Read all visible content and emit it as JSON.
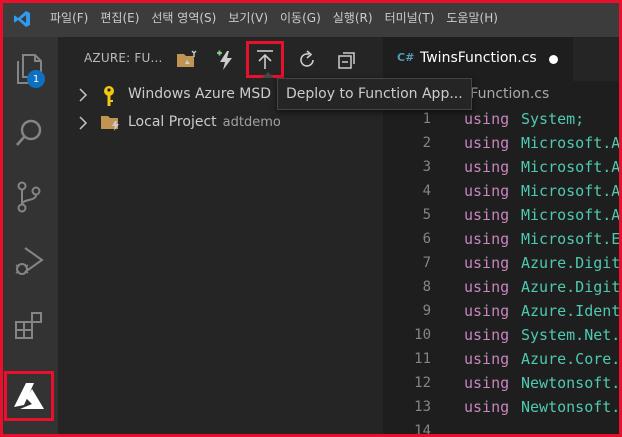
{
  "menu": [
    "파일(F)",
    "편집(E)",
    "선택 영역(S)",
    "보기(V)",
    "이동(G)",
    "실행(R)",
    "터미널(T)",
    "도움말(H)"
  ],
  "activity": {
    "explorer_badge": "1",
    "items": [
      "files-icon",
      "search-icon",
      "source-control-icon",
      "run-debug-icon",
      "extensions-icon",
      "azure-icon"
    ]
  },
  "sidebar": {
    "title": "AZURE: FU...",
    "tree": [
      {
        "label": "Windows Azure MSD",
        "desc": ""
      },
      {
        "label": "Local Project",
        "desc": "adtdemo"
      }
    ]
  },
  "tooltip": "Deploy to Function App...",
  "editor": {
    "tab": {
      "icon": "C#",
      "name": "TwinsFunction.cs"
    },
    "breadcrumb": "sFunction.cs",
    "lines": [
      {
        "n": "1",
        "kw": "using",
        "ns": "System;"
      },
      {
        "n": "2",
        "kw": "using",
        "ns": "Microsoft.A"
      },
      {
        "n": "3",
        "kw": "using",
        "ns": "Microsoft.A"
      },
      {
        "n": "4",
        "kw": "using",
        "ns": "Microsoft.A"
      },
      {
        "n": "5",
        "kw": "using",
        "ns": "Microsoft.A"
      },
      {
        "n": "6",
        "kw": "using",
        "ns": "Microsoft.E"
      },
      {
        "n": "7",
        "kw": "using",
        "ns": "Azure.Digit"
      },
      {
        "n": "8",
        "kw": "using",
        "ns": "Azure.Digit"
      },
      {
        "n": "9",
        "kw": "using",
        "ns": "Azure.Ident"
      },
      {
        "n": "10",
        "kw": "using",
        "ns": "System.Net."
      },
      {
        "n": "11",
        "kw": "using",
        "ns": "Azure.Core."
      },
      {
        "n": "12",
        "kw": "using",
        "ns": "Newtonsoft."
      },
      {
        "n": "13",
        "kw": "using",
        "ns": "Newtonsoft."
      },
      {
        "n": "14",
        "kw": "",
        "ns": ""
      }
    ]
  },
  "colors": {
    "highlight": "#e8112d",
    "keyword": "#c586c0",
    "type": "#4ec9b0",
    "badge": "#0e70c0"
  }
}
